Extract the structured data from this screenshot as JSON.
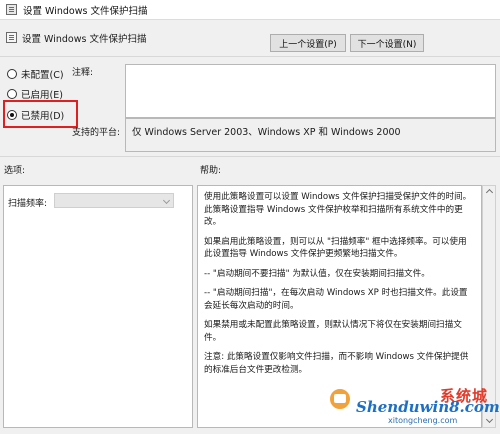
{
  "window": {
    "title": "设置 Windows 文件保护扫描"
  },
  "header": {
    "title": "设置 Windows 文件保护扫描"
  },
  "nav": {
    "prev_label": "上一个设置(P)",
    "next_label": "下一个设置(N)"
  },
  "state_options": [
    {
      "label": "未配置(C)",
      "checked": false
    },
    {
      "label": "已启用(E)",
      "checked": false
    },
    {
      "label": "已禁用(D)",
      "checked": true
    }
  ],
  "comment": {
    "label": "注释:",
    "value": ""
  },
  "platform": {
    "label": "支持的平台:",
    "value": "仅 Windows Server 2003、Windows XP 和 Windows 2000"
  },
  "options": {
    "section_label": "选项:",
    "freq_label": "扫描频率:",
    "freq_value": ""
  },
  "help": {
    "section_label": "帮助:",
    "paragraphs": [
      "使用此策略设置可以设置 Windows 文件保护扫描受保护文件的时间。此策略设置指导 Windows 文件保护枚举和扫描所有系统文件中的更改。",
      "如果启用此策略设置，则可以从 \"扫描频率\" 框中选择频率。可以使用此设置指导 Windows 文件保护更频繁地扫描文件。",
      "-- \"启动期间不要扫描\" 为默认值，仅在安装期间扫描文件。",
      "-- \"启动期间扫描\"，在每次启动 Windows XP 时也扫描文件。此设置会延长每次启动的时间。",
      "如果禁用或未配置此策略设置，则默认情况下将仅在安装期间扫描文件。",
      "注意: 此策略设置仅影响文件扫描，而不影响 Windows 文件保护提供的标准后台文件更改检测。"
    ]
  },
  "watermark": {
    "main": "Shenduwin8.com",
    "cn": "系统城",
    "sub": "xitongcheng.com"
  },
  "colors": {
    "highlight": "#e02020",
    "watermark_blue": "#1d6fc4",
    "watermark_red": "#e23b2a"
  }
}
